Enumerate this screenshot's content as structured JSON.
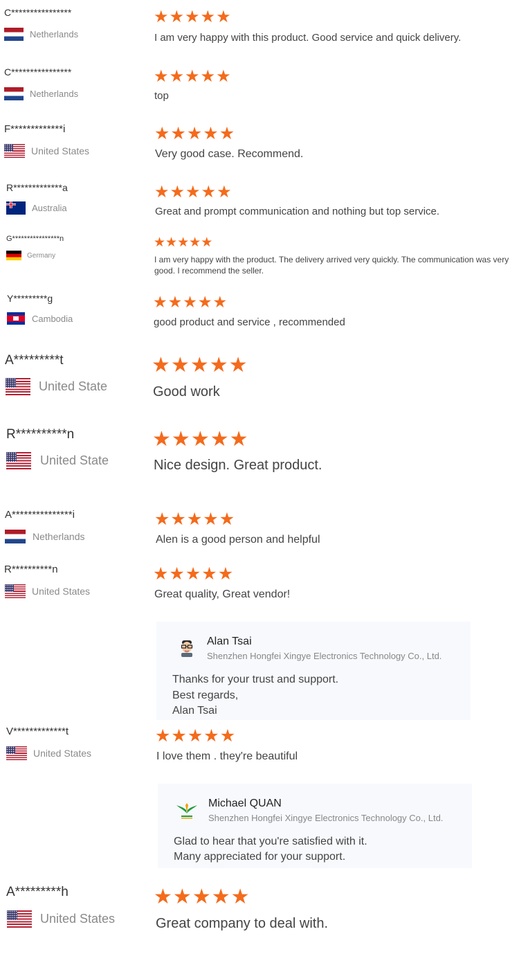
{
  "accent_color": "#f46b1c",
  "star_glyph": "★",
  "reviews": [
    {
      "buyer": "C****************",
      "country": "Netherlands",
      "flag": "nl-flag-icon",
      "rating": 5,
      "comment": "I am very happy with this product. Good service and quick delivery."
    },
    {
      "buyer": "C****************",
      "country": "Netherlands",
      "flag": "nl-flag-icon",
      "rating": 5,
      "comment": "top"
    },
    {
      "buyer": "F*************i",
      "country": "United States",
      "flag": "us-flag-icon",
      "rating": 5,
      "comment": "Very good case. Recommend."
    },
    {
      "buyer": "R*************a",
      "country": "Australia",
      "flag": "au-flag-icon",
      "rating": 5,
      "comment": "Great and prompt communication and nothing but top service."
    },
    {
      "buyer": "G****************n",
      "country": "Germany",
      "flag": "de-flag-icon",
      "rating": 5,
      "comment": "I am very happy with the product. The delivery arrived very quickly. The communication was very good. I recommend the seller."
    },
    {
      "buyer": "Y*********g",
      "country": "Cambodia",
      "flag": "kh-flag-icon",
      "rating": 5,
      "comment": "good product and service , recommended"
    },
    {
      "buyer": "A*********t",
      "country": "United State",
      "flag": "us-flag-icon",
      "rating": 5,
      "comment": "Good work"
    },
    {
      "buyer": "R**********n",
      "country": "United State",
      "flag": "us-flag-icon",
      "rating": 5,
      "comment": "Nice design. Great product."
    },
    {
      "buyer": "A***************i",
      "country": "Netherlands",
      "flag": "nl-flag-icon",
      "rating": 5,
      "comment": "Alen is a good person and helpful"
    },
    {
      "buyer": "R**********n",
      "country": "United States",
      "flag": "us-flag-icon",
      "rating": 5,
      "comment": "Great quality, Great vendor!"
    },
    {
      "buyer": "V*************t",
      "country": "United States",
      "flag": "us-flag-icon",
      "rating": 5,
      "comment": "I love them . they're beautiful"
    },
    {
      "buyer": "A*********h",
      "country": "United States",
      "flag": "us-flag-icon",
      "rating": 5,
      "comment": "Great company to deal with."
    }
  ],
  "replies": [
    {
      "name": "Alan Tsai",
      "company": "Shenzhen Hongfei Xingye Electronics Technology Co., Ltd.",
      "avatar": "person-avatar-icon",
      "lines": [
        "Thanks for your trust and support.",
        "Best regards,",
        "Alan Tsai"
      ]
    },
    {
      "name": "Michael QUAN",
      "company": "Shenzhen Hongfei Xingye Electronics Technology Co., Ltd.",
      "avatar": "company-logo-icon",
      "lines": [
        "Glad to hear that you're satisfied with it.",
        "Many appreciated for your support."
      ]
    }
  ]
}
